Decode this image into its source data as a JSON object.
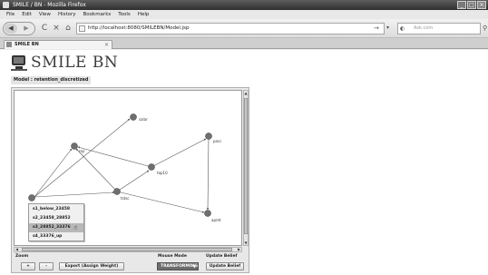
{
  "browser": {
    "title": "SMILE / BN - Mozilla Firefox",
    "menu": [
      "File",
      "Edit",
      "View",
      "History",
      "Bookmarks",
      "Tools",
      "Help"
    ],
    "url": "http://localhost:8080/SMILEBN/Model.jsp",
    "search_placeholder": "Ask.com",
    "tab_label": "SMILE BN",
    "tab_close": "×",
    "icons": {
      "back": "◀",
      "forward": "▶",
      "reload": "C",
      "stop": "×",
      "home": "⌂",
      "go": "→",
      "dropdown": "▾",
      "search_engine": "◐",
      "search": "⚲",
      "minimize": "_",
      "maximize": "□",
      "close": "×"
    }
  },
  "page": {
    "logo_text": "SMILE BN",
    "model_label": "Model : retention_discretized",
    "nodes": [
      {
        "id": "n1",
        "label": "salar"
      },
      {
        "id": "n2",
        "label": "rejr"
      },
      {
        "id": "n3",
        "label": "pacc"
      },
      {
        "id": "n4",
        "label": "top10"
      },
      {
        "id": "n5",
        "label": "tstsc"
      },
      {
        "id": "n6",
        "label": "apret"
      },
      {
        "id": "n7",
        "label": ""
      }
    ],
    "context_menu": [
      {
        "label": "s1_below_23458",
        "selected": false
      },
      {
        "label": "s2_23458_28852",
        "selected": false
      },
      {
        "label": "s3_28852_33376",
        "selected": true
      },
      {
        "label": "s4_33376_up",
        "selected": false
      }
    ],
    "controls": {
      "zoom_title": "Zoom",
      "zoom_in": "+",
      "zoom_out": "-",
      "export_button": "Export (Assign Weight)",
      "mouse_mode_title": "Mouse Mode",
      "mouse_mode_value": "TRANSFORMING",
      "update_belief_title": "Update Belief",
      "update_belief_button": "Update Belief"
    }
  }
}
